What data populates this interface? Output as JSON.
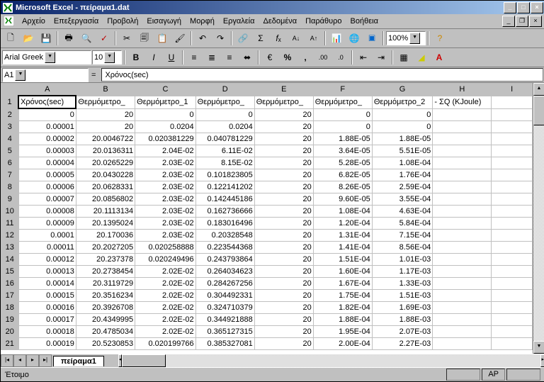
{
  "title": "Microsoft Excel - πείραμα1.dat",
  "menu": [
    "Αρχείο",
    "Επεξεργασία",
    "Προβολή",
    "Εισαγωγή",
    "Μορφή",
    "Εργαλεία",
    "Δεδομένα",
    "Παράθυρο",
    "Βοήθεια"
  ],
  "font": {
    "name": "Arial Greek",
    "size": "10"
  },
  "zoom": "100%",
  "namebox": "A1",
  "formula": "Χρόνος(sec)",
  "columns": [
    "A",
    "B",
    "C",
    "D",
    "E",
    "F",
    "G",
    "H",
    "I"
  ],
  "headers": {
    "A": "Χρόνος(sec)",
    "B": "Θερμόμετρο_",
    "C": "Θερμόμετρο_1",
    "D": "Θερμόμετρο_",
    "E": "Θερμόμετρο_",
    "F": "Θερμόμετρο_",
    "G": "Θερμόμετρο_2",
    "H": "- ΣQ (KJoule)"
  },
  "rows": [
    {
      "n": 2,
      "A": "0",
      "B": "20",
      "C": "0",
      "D": "0",
      "E": "20",
      "F": "0",
      "G": "0"
    },
    {
      "n": 3,
      "A": "0.00001",
      "B": "20",
      "C": "0.0204",
      "D": "0.0204",
      "E": "20",
      "F": "0",
      "G": "0"
    },
    {
      "n": 4,
      "A": "0.00002",
      "B": "20.0046722",
      "C": "0.020381229",
      "D": "0.040781229",
      "E": "20",
      "F": "1.88E-05",
      "G": "1.88E-05"
    },
    {
      "n": 5,
      "A": "0.00003",
      "B": "20.0136311",
      "C": "2.04E-02",
      "D": "6.11E-02",
      "E": "20",
      "F": "3.64E-05",
      "G": "5.51E-05"
    },
    {
      "n": 6,
      "A": "0.00004",
      "B": "20.0265229",
      "C": "2.03E-02",
      "D": "8.15E-02",
      "E": "20",
      "F": "5.28E-05",
      "G": "1.08E-04"
    },
    {
      "n": 7,
      "A": "0.00005",
      "B": "20.0430228",
      "C": "2.03E-02",
      "D": "0.101823805",
      "E": "20",
      "F": "6.82E-05",
      "G": "1.76E-04"
    },
    {
      "n": 8,
      "A": "0.00006",
      "B": "20.0628331",
      "C": "2.03E-02",
      "D": "0.122141202",
      "E": "20",
      "F": "8.26E-05",
      "G": "2.59E-04"
    },
    {
      "n": 9,
      "A": "0.00007",
      "B": "20.0856802",
      "C": "2.03E-02",
      "D": "0.142445186",
      "E": "20",
      "F": "9.60E-05",
      "G": "3.55E-04"
    },
    {
      "n": 10,
      "A": "0.00008",
      "B": "20.1113134",
      "C": "2.03E-02",
      "D": "0.162736666",
      "E": "20",
      "F": "1.08E-04",
      "G": "4.63E-04"
    },
    {
      "n": 11,
      "A": "0.00009",
      "B": "20.1395024",
      "C": "2.03E-02",
      "D": "0.183016496",
      "E": "20",
      "F": "1.20E-04",
      "G": "5.84E-04"
    },
    {
      "n": 12,
      "A": "0.0001",
      "B": "20.170036",
      "C": "2.03E-02",
      "D": "0.20328548",
      "E": "20",
      "F": "1.31E-04",
      "G": "7.15E-04"
    },
    {
      "n": 13,
      "A": "0.00011",
      "B": "20.2027205",
      "C": "0.020258888",
      "D": "0.223544368",
      "E": "20",
      "F": "1.41E-04",
      "G": "8.56E-04"
    },
    {
      "n": 14,
      "A": "0.00012",
      "B": "20.237378",
      "C": "0.020249496",
      "D": "0.243793864",
      "E": "20",
      "F": "1.51E-04",
      "G": "1.01E-03"
    },
    {
      "n": 15,
      "A": "0.00013",
      "B": "20.2738454",
      "C": "2.02E-02",
      "D": "0.264034623",
      "E": "20",
      "F": "1.60E-04",
      "G": "1.17E-03"
    },
    {
      "n": 16,
      "A": "0.00014",
      "B": "20.3119729",
      "C": "2.02E-02",
      "D": "0.284267256",
      "E": "20",
      "F": "1.67E-04",
      "G": "1.33E-03"
    },
    {
      "n": 17,
      "A": "0.00015",
      "B": "20.3516234",
      "C": "2.02E-02",
      "D": "0.304492331",
      "E": "20",
      "F": "1.75E-04",
      "G": "1.51E-03"
    },
    {
      "n": 18,
      "A": "0.00016",
      "B": "20.3926708",
      "C": "2.02E-02",
      "D": "0.324710379",
      "E": "20",
      "F": "1.82E-04",
      "G": "1.69E-03"
    },
    {
      "n": 19,
      "A": "0.00017",
      "B": "20.4349995",
      "C": "2.02E-02",
      "D": "0.344921888",
      "E": "20",
      "F": "1.88E-04",
      "G": "1.88E-03"
    },
    {
      "n": 20,
      "A": "0.00018",
      "B": "20.4785034",
      "C": "2.02E-02",
      "D": "0.365127315",
      "E": "20",
      "F": "1.95E-04",
      "G": "2.07E-03"
    },
    {
      "n": 21,
      "A": "0.00019",
      "B": "20.5230853",
      "C": "0.020199766",
      "D": "0.385327081",
      "E": "20",
      "F": "2.00E-04",
      "G": "2.27E-03"
    }
  ],
  "sheetname": "πείραμα1",
  "status": "Έτοιμο",
  "ap": "AP"
}
